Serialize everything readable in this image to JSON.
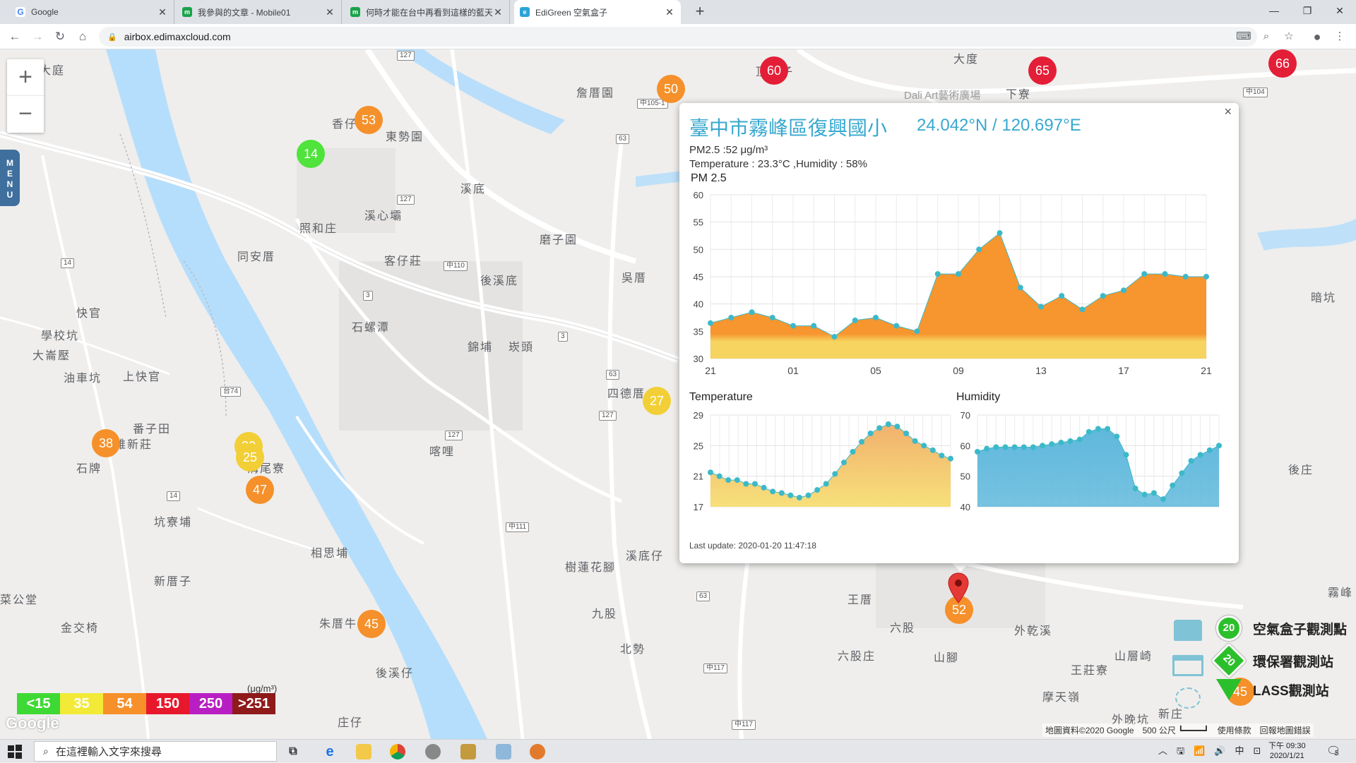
{
  "browser": {
    "tabs": [
      {
        "title": "Google",
        "icon": "google-icon",
        "active": false
      },
      {
        "title": "我參與的文章 - Mobile01",
        "icon": "mobile01-icon",
        "active": false
      },
      {
        "title": "何時才能在台中再看到這樣的藍天",
        "icon": "mobile01-icon",
        "active": false
      },
      {
        "title": "EdiGreen 空氣盒子",
        "icon": "edigreen-icon",
        "active": true
      }
    ],
    "url": "airbox.edimaxcloud.com",
    "new_tab": "+",
    "window_min": "—",
    "window_max": "❐",
    "window_close": "✕"
  },
  "map": {
    "menu_label": "MENU",
    "zoom_in": "+",
    "zoom_out": "−",
    "places": [
      "頂厝子",
      "詹厝園",
      "香仔園",
      "東勢園",
      "溪底",
      "溪心壩",
      "照和庄",
      "磨子園",
      "同安厝",
      "客仔莊",
      "後溪底",
      "吳厝",
      "快官",
      "學校坑",
      "大崙壓",
      "油車坑",
      "上快官",
      "石螺潭",
      "錦埔",
      "崁頭",
      "番子田",
      "維新莊",
      "四德厝",
      "石牌",
      "喀哩",
      "溝尾寮",
      "坑寮埔",
      "相思埔",
      "新厝子",
      "樹蓮花腳",
      "溪底仔",
      "菜公堂",
      "金交椅",
      "朱厝牛",
      "九股",
      "北勢",
      "王厝",
      "六股",
      "六股庄",
      "山腳",
      "外乾溪",
      "王莊寮",
      "後溪仔",
      "摩天嶺",
      "庄仔",
      "暗坑",
      "霧峰",
      "下寮",
      "山層崎",
      "外晚坑",
      "後庄",
      "新庄",
      "Dali Art藝術廣場",
      "大度",
      "大庭"
    ],
    "roads": [
      "127",
      "63",
      "127",
      "中110",
      "3",
      "3",
      "127",
      "63",
      "127",
      "14",
      "14",
      "中111",
      "63",
      "中117",
      "中117",
      "台74",
      "中104",
      "中105-1",
      "3"
    ],
    "markers": [
      {
        "value": "60",
        "color": "red"
      },
      {
        "value": "65",
        "color": "red"
      },
      {
        "value": "66",
        "color": "red"
      },
      {
        "value": "50",
        "color": "orange"
      },
      {
        "value": "53",
        "color": "orange"
      },
      {
        "value": "14",
        "color": "green"
      },
      {
        "value": "27",
        "color": "yellow"
      },
      {
        "value": "38",
        "color": "orange"
      },
      {
        "value": "20",
        "color": "yellow"
      },
      {
        "value": "25",
        "color": "yellow"
      },
      {
        "value": "47",
        "color": "orange"
      },
      {
        "value": "45",
        "color": "orange"
      },
      {
        "value": "52",
        "color": "orange"
      },
      {
        "value": "45",
        "color": "orange"
      }
    ],
    "legend": [
      {
        "label": "<15",
        "color": "#3fd935"
      },
      {
        "label": "35",
        "color": "#f2ea37"
      },
      {
        "label": "54",
        "color": "#f7902a"
      },
      {
        "label": "150",
        "color": "#e8182c"
      },
      {
        "label": "250",
        "color": "#b81fc2"
      },
      {
        "label": ">251",
        "color": "#8e1a1a"
      }
    ],
    "legend_unit": "(μg/m³)",
    "google_logo": "Google",
    "attribution": "地圖資料©2020 Google　500 公尺 ┗━━━━┛　使用條款　回報地圖錯誤",
    "station_legend": [
      {
        "badge": "20",
        "label": "空氣盒子觀測點",
        "icon": "airbox-icon"
      },
      {
        "badge": "20",
        "label": "環保署觀測站",
        "icon": "epa-icon"
      },
      {
        "badge": "20",
        "label": "LASS觀測站",
        "icon": "lass-icon"
      }
    ]
  },
  "popup": {
    "close": "×",
    "title": "臺中市霧峰區復興國小",
    "coords": "24.042°N / 120.697°E",
    "pm25_line": "PM2.5 :52 μg/m³",
    "temp_line": "Temperature : 23.3°C ,Humidity : 58%",
    "pm_chart_label": "PM 2.5",
    "temp_chart_label": "Temperature",
    "hum_chart_label": "Humidity",
    "last_update": "Last update: 2020-01-20 11:47:18"
  },
  "chart_data": [
    {
      "type": "area",
      "title": "PM 2.5",
      "ylim": [
        30,
        60
      ],
      "yticks": [
        30,
        35,
        40,
        45,
        50,
        55,
        60
      ],
      "xticks": [
        "21",
        "01",
        "05",
        "09",
        "13",
        "17",
        "21"
      ],
      "grid": true,
      "threshold": 35,
      "threshold_colors": {
        "below": "#f7d35f",
        "above": "#f7952e"
      },
      "point_color": "#3cb9c9",
      "values": [
        36.5,
        37.5,
        38.5,
        37.5,
        36,
        36,
        34,
        37,
        37.5,
        36,
        35,
        45.5,
        45.5,
        50,
        53,
        43,
        39.5,
        41.5,
        39,
        41.5,
        42.5,
        45.5,
        45.5,
        45,
        45
      ]
    },
    {
      "type": "area",
      "title": "Temperature",
      "ylim": [
        17,
        29
      ],
      "yticks": [
        17,
        21,
        25,
        29
      ],
      "grid": true,
      "fill_gradient": [
        "#f7e07a",
        "#f1b16d"
      ],
      "point_color": "#3cb9c9",
      "values": [
        21.5,
        21,
        20.5,
        20.5,
        20,
        20,
        19.5,
        19,
        18.8,
        18.5,
        18.2,
        18.5,
        19.2,
        20,
        21.3,
        22.8,
        24.2,
        25.5,
        26.6,
        27.3,
        27.8,
        27.5,
        26.6,
        25.6,
        25,
        24.4,
        23.7,
        23.3
      ]
    },
    {
      "type": "area",
      "title": "Humidity",
      "ylim": [
        40,
        70
      ],
      "yticks": [
        40,
        50,
        60,
        70
      ],
      "grid": true,
      "fill_color": "#5fb8dc",
      "point_color": "#3cb9c9",
      "values": [
        58,
        59,
        59.5,
        59.5,
        59.5,
        59.5,
        59.5,
        60,
        60.5,
        61,
        61.5,
        62,
        64.5,
        65.5,
        65.5,
        63,
        57,
        46,
        44,
        44.5,
        42.5,
        47,
        51,
        55,
        57,
        58.5,
        60
      ]
    }
  ],
  "taskbar": {
    "search_placeholder": "在這裡輸入文字來搜尋",
    "tray": "︿　🖫　📶　🔊　中　⊡",
    "time": "下午 09:30",
    "date": "2020/1/21",
    "notif_count": "5"
  }
}
